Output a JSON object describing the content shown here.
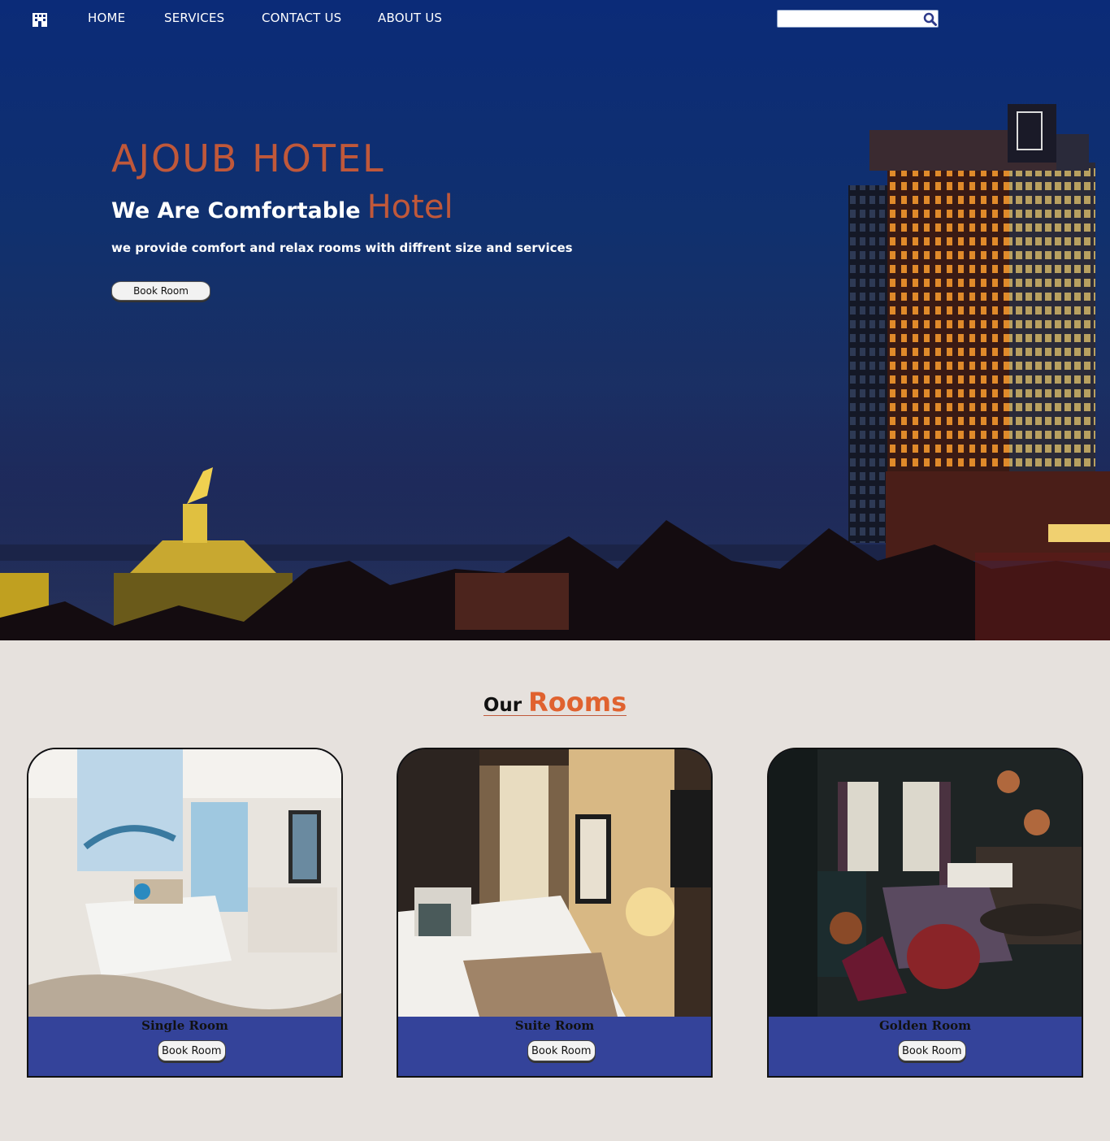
{
  "nav": {
    "logo_icon": "hotel-building-icon",
    "links": [
      "HOME",
      "SERVICES",
      "CONTACT US",
      "ABOUT US"
    ],
    "search": {
      "value": "",
      "placeholder": "",
      "icon": "search-icon"
    }
  },
  "hero": {
    "title": "AJOUB HOTEL",
    "subtitle_lead": "We Are Comfortable",
    "subtitle_accent": "Hotel",
    "description": "we provide comfort and relax rooms with diffrent size and services",
    "button_label": "Book Room"
  },
  "rooms_section": {
    "heading_lead": "Our",
    "heading_accent": "Rooms",
    "cards": [
      {
        "title": "Single Room",
        "button_label": "Book Room"
      },
      {
        "title": "Suite Room",
        "button_label": "Book Room"
      },
      {
        "title": "Golden Room",
        "button_label": "Book Room"
      }
    ]
  },
  "colors": {
    "accent": "#c0583a",
    "rooms_accent": "#e0622f",
    "card_footer": "#34439a",
    "page_background": "#e6e1dd"
  }
}
